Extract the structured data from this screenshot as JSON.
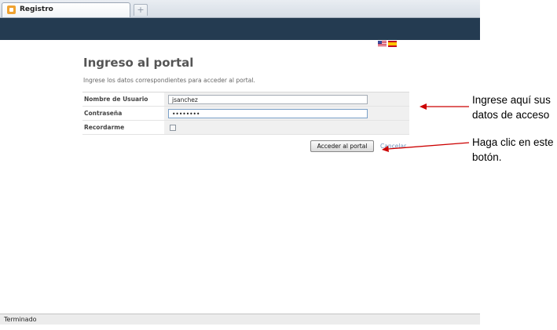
{
  "browser": {
    "tab_title": "Registro",
    "new_tab_symbol": "+",
    "status": "Terminado"
  },
  "languages": [
    "en-flag-icon",
    "es-flag-icon"
  ],
  "login": {
    "title": "Ingreso al portal",
    "subtitle": "Ingrese los datos correspondientes para acceder al portal.",
    "username_label": "Nombre de Usuario",
    "username_value": "jsanchez",
    "password_label": "Contraseña",
    "password_value": "••••••••",
    "remember_label": "Recordarme",
    "remember_checked": false,
    "submit_label": "Acceder al portal",
    "cancel_label": "Cancelar"
  },
  "annotations": {
    "credentials_line1": "Ingrese aquí sus",
    "credentials_line2": "datos de acceso",
    "button_line1": "Haga clic en este",
    "button_line2": "botón."
  },
  "colors": {
    "header_bar": "#243b51",
    "arrow": "#cc0000",
    "link": "#6d8fb8"
  }
}
